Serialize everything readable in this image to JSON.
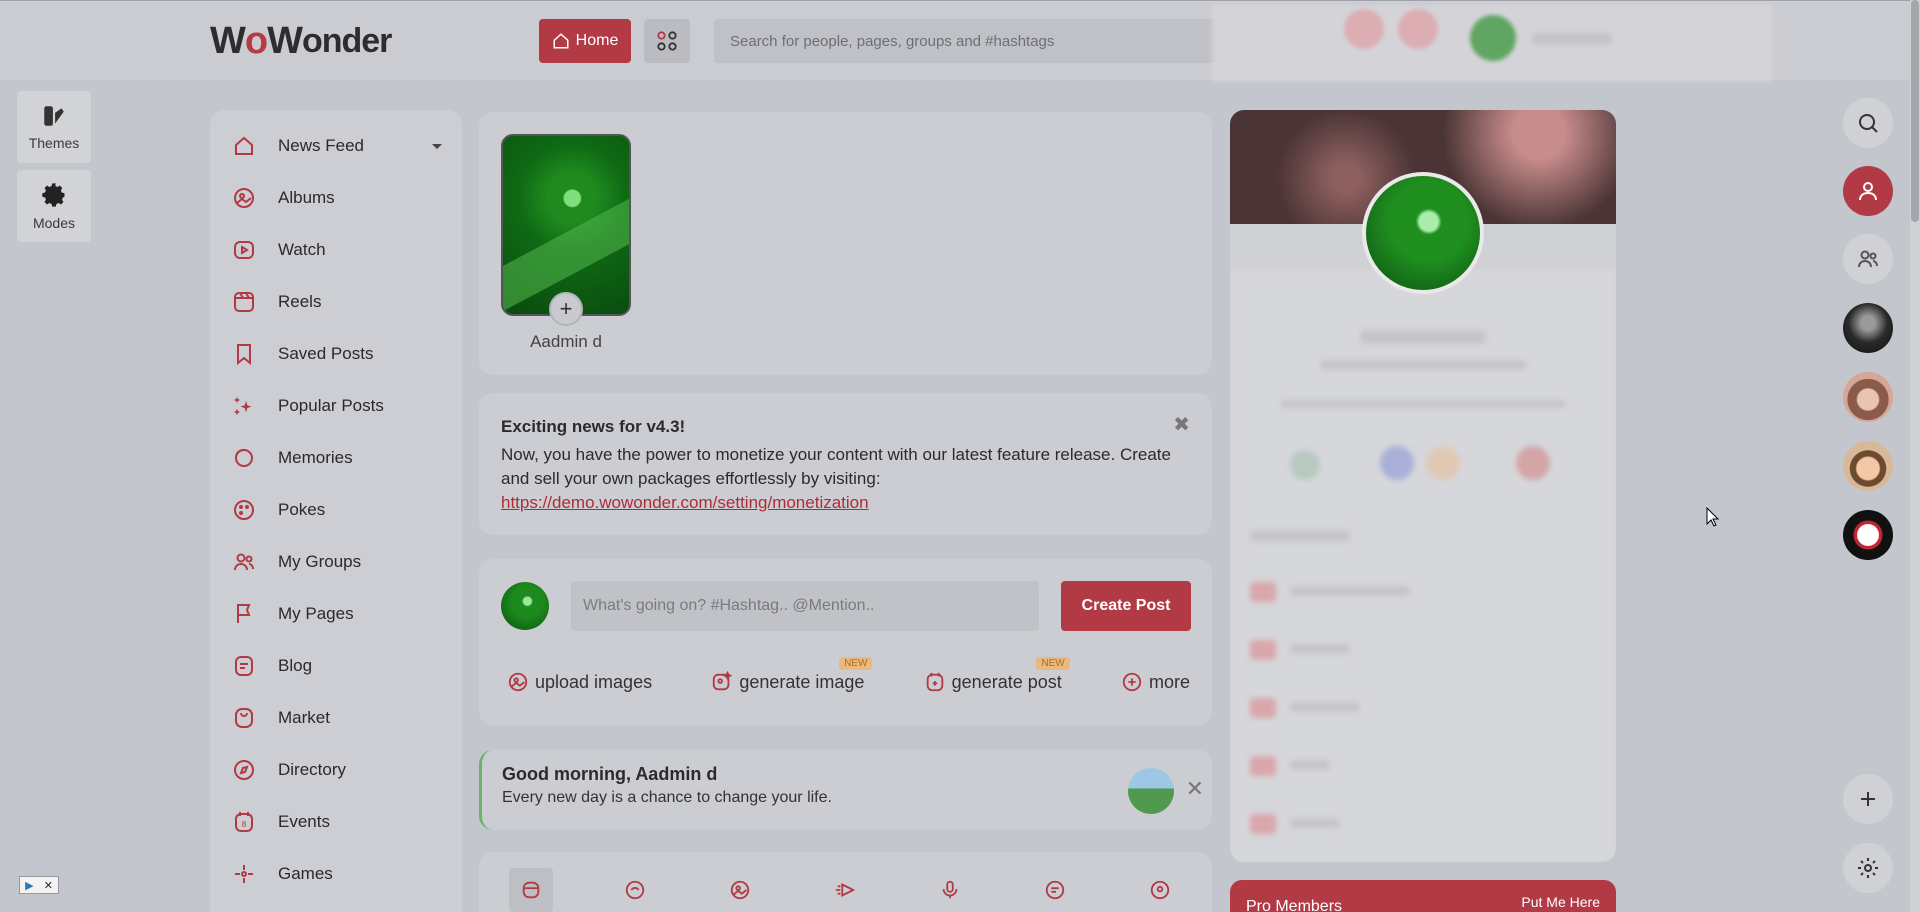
{
  "header": {
    "logo_text": "WoWonder",
    "home_label": "Home",
    "search_placeholder": "Search for people, pages, groups and #hashtags"
  },
  "side_tools": {
    "themes_label": "Themes",
    "modes_label": "Modes"
  },
  "menu": {
    "items": [
      {
        "label": "News Feed",
        "icon": "home-icon"
      },
      {
        "label": "Albums",
        "icon": "albums-icon"
      },
      {
        "label": "Watch",
        "icon": "watch-icon"
      },
      {
        "label": "Reels",
        "icon": "reels-icon"
      },
      {
        "label": "Saved Posts",
        "icon": "bookmark-icon"
      },
      {
        "label": "Popular Posts",
        "icon": "sparkle-icon"
      },
      {
        "label": "Memories",
        "icon": "memories-icon"
      },
      {
        "label": "Pokes",
        "icon": "pokes-icon"
      },
      {
        "label": "My Groups",
        "icon": "groups-icon"
      },
      {
        "label": "My Pages",
        "icon": "flag-icon"
      },
      {
        "label": "Blog",
        "icon": "blog-icon"
      },
      {
        "label": "Market",
        "icon": "market-icon"
      },
      {
        "label": "Directory",
        "icon": "compass-icon"
      },
      {
        "label": "Events",
        "icon": "calendar-icon"
      },
      {
        "label": "Games",
        "icon": "games-icon"
      }
    ]
  },
  "story": {
    "name": "Aadmin d"
  },
  "announcement": {
    "title": "Exciting news for v4.3!",
    "body": "Now, you have the power to monetize your content with our latest feature release. Create and sell your own packages effortlessly by visiting:",
    "link": "https://demo.wowonder.com/setting/monetization"
  },
  "composer": {
    "placeholder": "What's going on? #Hashtag.. @Mention..",
    "create_label": "Create Post",
    "actions": [
      {
        "label": "upload images",
        "badge": ""
      },
      {
        "label": "generate image",
        "badge": "NEW"
      },
      {
        "label": "generate post",
        "badge": "NEW"
      },
      {
        "label": "more",
        "badge": ""
      }
    ]
  },
  "greeting": {
    "title": "Good morning, Aadmin d",
    "text": "Every new day is a chance to change your life."
  },
  "pro_members": {
    "title": "Pro Members",
    "link": "Put Me Here"
  },
  "colors": {
    "accent": "#b23a44",
    "background": "#c3c6cd"
  }
}
